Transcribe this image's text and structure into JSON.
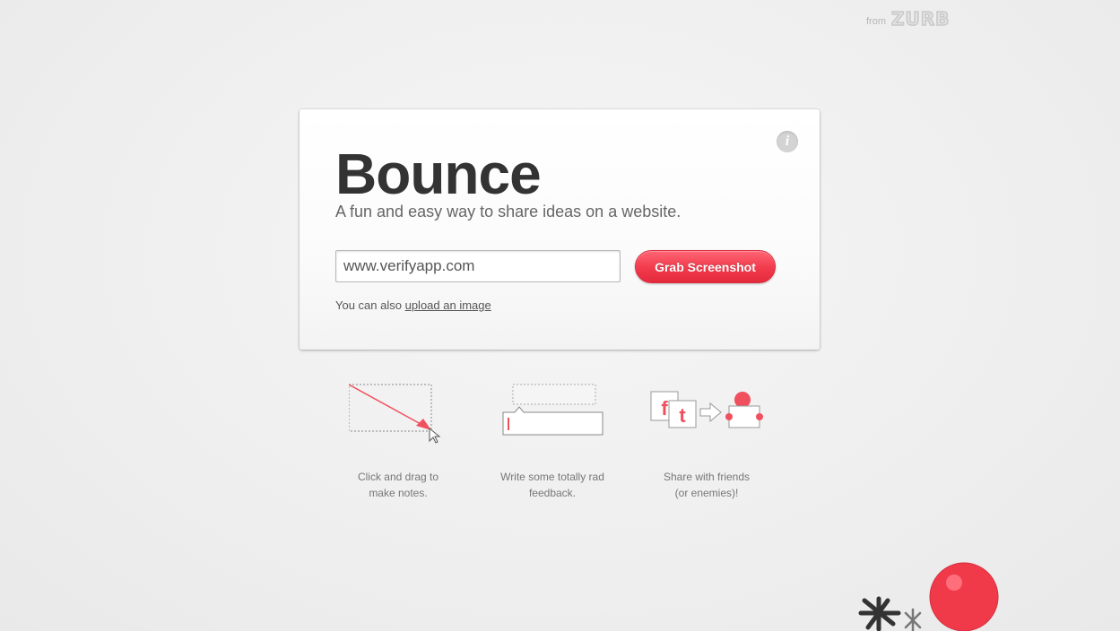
{
  "brand": {
    "from_text": "from",
    "logo_text": "ZURB"
  },
  "card": {
    "info_icon": "i",
    "title": "Bounce",
    "subtitle": "A fun and easy way to share ideas on a website.",
    "url_input": {
      "value": "www.verifyapp.com"
    },
    "grab_button_label": "Grab Screenshot",
    "upload_prefix": "You can also ",
    "upload_link": "upload an image"
  },
  "features": [
    {
      "icon": "drag-arrow-icon",
      "line1": "Click and drag to",
      "line2": "make notes."
    },
    {
      "icon": "feedback-box-icon",
      "line1": "Write some totally rad",
      "line2": "feedback."
    },
    {
      "icon": "share-icon",
      "line1": "Share with friends",
      "line2": "(or enemies)!"
    }
  ],
  "colors": {
    "accent": "#f13a4b",
    "text_dark": "#333333",
    "text_muted": "#777777",
    "background": "#efefef"
  }
}
